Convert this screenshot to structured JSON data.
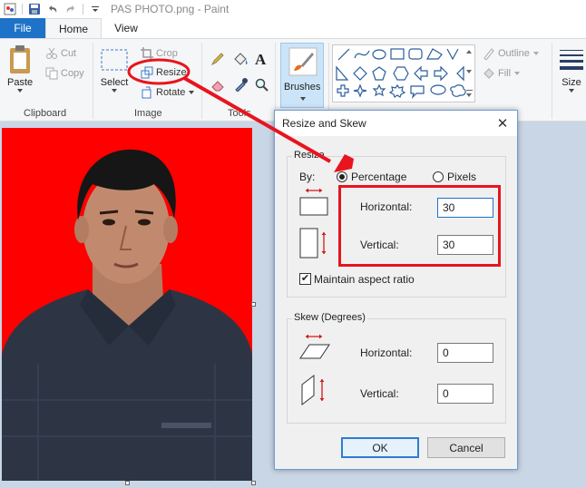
{
  "window": {
    "title": "PAS PHOTO.png - Paint"
  },
  "tabs": {
    "file": "File",
    "home": "Home",
    "view": "View"
  },
  "ribbon": {
    "paste": "Paste",
    "cut": "Cut",
    "copy": "Copy",
    "clipboard_group": "Clipboard",
    "select": "Select",
    "crop": "Crop",
    "resize": "Resize",
    "rotate": "Rotate",
    "image_group": "Image",
    "tools_group": "Tools",
    "brushes": "Brushes",
    "outline": "Outline",
    "fill": "Fill",
    "size": "Size"
  },
  "dialog": {
    "title": "Resize and Skew",
    "resize_legend": "Resize",
    "by_label": "By:",
    "percentage": "Percentage",
    "pixels": "Pixels",
    "horizontal_label": "Horizontal:",
    "horizontal_value": "30",
    "vertical_label": "Vertical:",
    "vertical_value": "30",
    "maintain_aspect": "Maintain aspect ratio",
    "maintain_checked": "✔",
    "skew_legend": "Skew (Degrees)",
    "skew_horizontal_label": "Horizontal:",
    "skew_horizontal_value": "0",
    "skew_vertical_label": "Vertical:",
    "skew_vertical_value": "0",
    "ok": "OK",
    "cancel": "Cancel",
    "close": "✕"
  },
  "colors": {
    "accent": "#1e72c8",
    "annotation": "#e8141e",
    "photo_bg": "#ff0000"
  }
}
